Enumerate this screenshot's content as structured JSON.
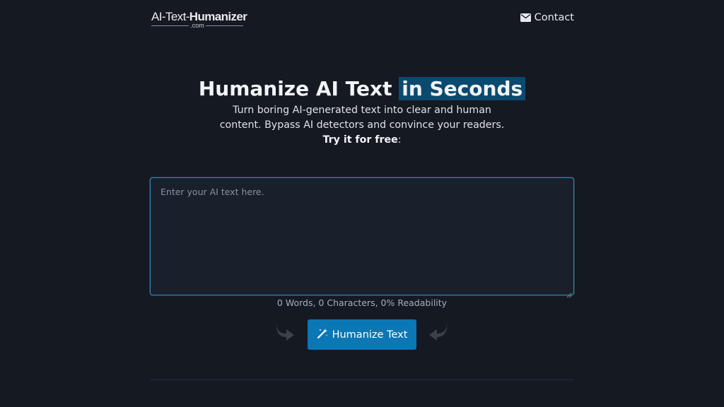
{
  "header": {
    "logo": {
      "part1": "AI-Text-",
      "part2": "Humanizer",
      "sub": ".com"
    },
    "contact_label": "Contact"
  },
  "hero": {
    "title_main": "Humanize AI Text",
    "title_highlight": "in Seconds",
    "subtitle_line1": "Turn boring AI-generated text into clear and human",
    "subtitle_line2": "content. Bypass AI detectors and convince your readers.",
    "try_label": "Try it for free",
    "try_suffix": ":"
  },
  "editor": {
    "placeholder": "Enter your AI text here.",
    "value": ""
  },
  "stats": {
    "counter_text": "0 Words, 0 Characters, 0% Readability"
  },
  "actions": {
    "humanize_label": "Humanize Text"
  },
  "icons": {
    "contact": "envelope-icon",
    "humanize": "magic-wand-icon",
    "left_arrow": "curved-arrow-right-icon",
    "right_arrow": "curved-arrow-left-icon"
  },
  "colors": {
    "background": "#151922",
    "accent": "#0b77b5",
    "highlight": "#0b4a6f",
    "input_border": "#3a86b8"
  }
}
